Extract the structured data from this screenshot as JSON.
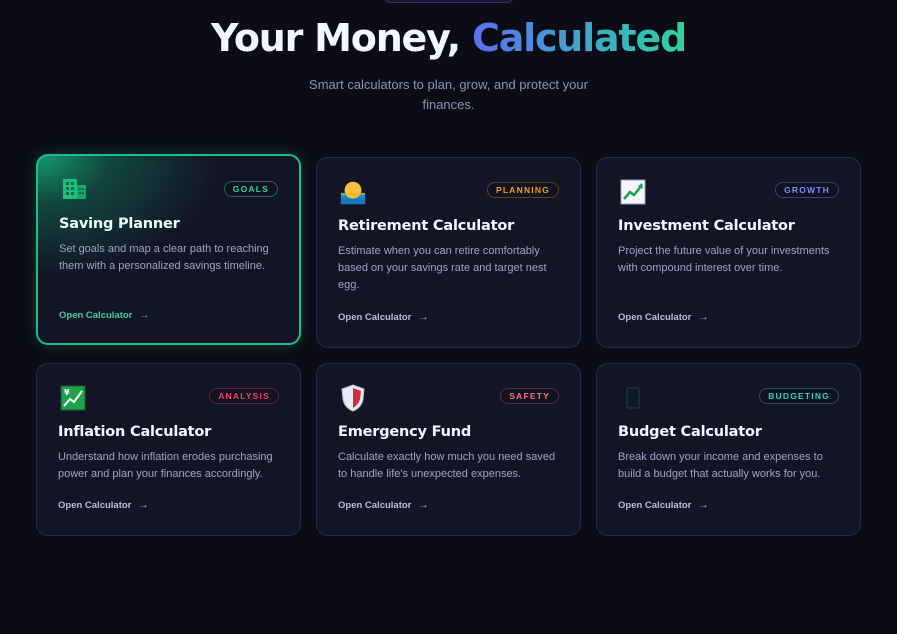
{
  "hero": {
    "title_main": "Your Money, ",
    "title_accent": "Calculated",
    "subtitle": "Smart calculators to plan, grow, and protect your finances."
  },
  "colors": {
    "background": "#0b0c16",
    "card": "#131527",
    "active_border": "#1dbf86"
  },
  "cards": [
    {
      "title": "Saving Planner",
      "badge": "GOALS",
      "badge_color": "#34d399",
      "icon": "bank-building-icon",
      "description": "Set goals and map a clear path to reaching them with a personalized savings timeline.",
      "cta": "Open Calculator",
      "active": true
    },
    {
      "title": "Retirement Calculator",
      "badge": "PLANNING",
      "badge_color": "#f59e0b",
      "icon": "sunset-icon",
      "description": "Estimate when you can retire comfortably based on your savings rate and target nest egg.",
      "cta": "Open Calculator",
      "active": false
    },
    {
      "title": "Investment Calculator",
      "badge": "GROWTH",
      "badge_color": "#818cf8",
      "icon": "chart-increasing-icon",
      "description": "Project the future value of your investments with compound interest over time.",
      "cta": "Open Calculator",
      "active": false
    },
    {
      "title": "Inflation Calculator",
      "badge": "ANALYSIS",
      "badge_color": "#f43f5e",
      "icon": "yen-chart-icon",
      "description": "Understand how inflation erodes purchasing power and plan your finances accordingly.",
      "cta": "Open Calculator",
      "active": false
    },
    {
      "title": "Emergency Fund",
      "badge": "SAFETY",
      "badge_color": "#fb7185",
      "icon": "shield-icon",
      "description": "Calculate exactly how much you need saved to handle life's unexpected expenses.",
      "cta": "Open Calculator",
      "active": false
    },
    {
      "title": "Budget Calculator",
      "badge": "BUDGETING",
      "badge_color": "#2dd4bf",
      "icon": "phone-icon",
      "description": "Break down your income and expenses to build a budget that actually works for you.",
      "cta": "Open Calculator",
      "active": false
    }
  ]
}
